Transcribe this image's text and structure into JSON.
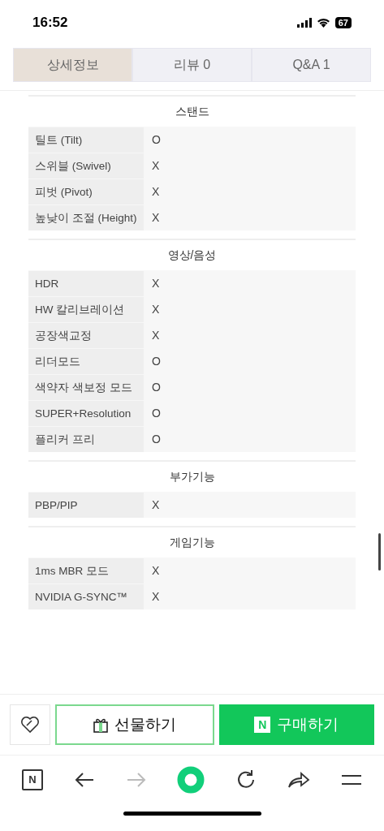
{
  "status_bar": {
    "time": "16:52",
    "battery": "67"
  },
  "tabs": [
    {
      "label": "상세정보",
      "selected": true
    },
    {
      "label": "리뷰 0",
      "selected": false
    },
    {
      "label": "Q&A 1",
      "selected": false
    }
  ],
  "sections": [
    {
      "title": "스탠드",
      "rows": [
        {
          "label": "틸트 (Tilt)",
          "value": "O"
        },
        {
          "label": "스위블 (Swivel)",
          "value": "X"
        },
        {
          "label": "피벗 (Pivot)",
          "value": "X"
        },
        {
          "label": "높낮이 조절 (Height)",
          "value": "X"
        }
      ]
    },
    {
      "title": "영상/음성",
      "rows": [
        {
          "label": "HDR",
          "value": "X"
        },
        {
          "label": "HW 칼리브레이션",
          "value": "X"
        },
        {
          "label": "공장색교정",
          "value": "X"
        },
        {
          "label": "리더모드",
          "value": "O"
        },
        {
          "label": "색약자 색보정 모드",
          "value": "O"
        },
        {
          "label": "SUPER+Resolution",
          "value": "O"
        },
        {
          "label": "플리커 프리",
          "value": "O"
        }
      ]
    },
    {
      "title": "부가기능",
      "rows": [
        {
          "label": "PBP/PIP",
          "value": "X"
        }
      ]
    },
    {
      "title": "게임기능",
      "rows": [
        {
          "label": "1ms MBR 모드",
          "value": "X"
        },
        {
          "label": "NVIDIA G-SYNC™",
          "value": "X"
        }
      ]
    }
  ],
  "actions": {
    "gift_button": "선물하기",
    "buy_badge": "N",
    "buy_button": "구매하기"
  },
  "toolbar": {
    "home_badge": "N"
  }
}
